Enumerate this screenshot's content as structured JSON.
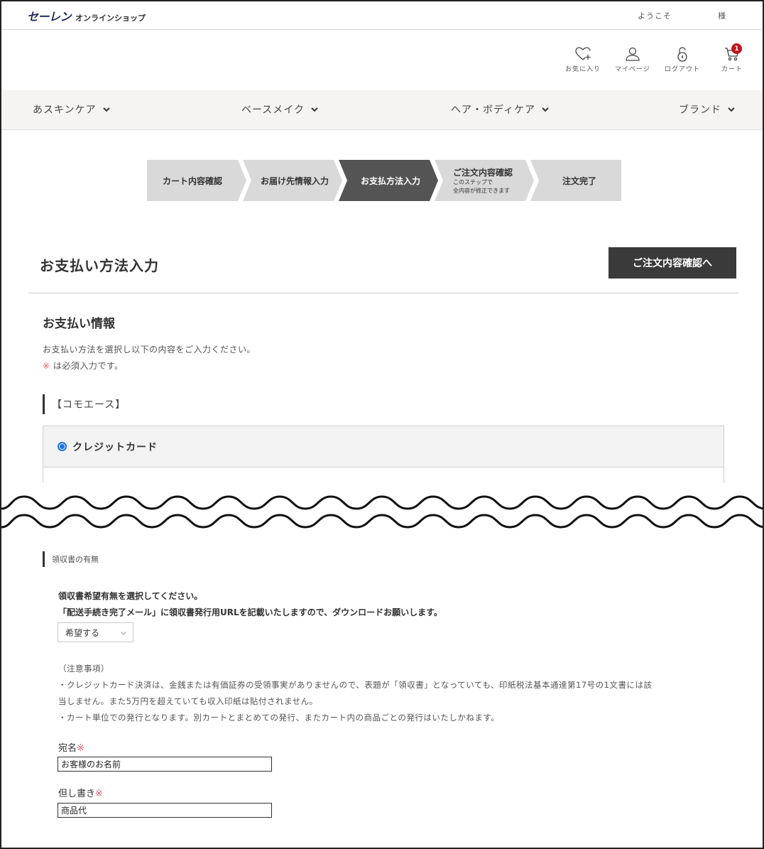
{
  "header": {
    "logo_main": "セーレン",
    "logo_sub": "オンラインショップ",
    "welcome": "ようこそ",
    "honorific": "様"
  },
  "header_icons": [
    {
      "label": "お気に入り",
      "icon": "heart-plus-icon"
    },
    {
      "label": "マイページ",
      "icon": "user-icon"
    },
    {
      "label": "ログアウト",
      "icon": "unlock-icon"
    },
    {
      "label": "カート",
      "icon": "cart-icon",
      "badge": "1"
    }
  ],
  "nav": {
    "items": [
      {
        "label": "あスキンケア"
      },
      {
        "label": "ベースメイク"
      },
      {
        "label": "ヘア・ボディケア"
      },
      {
        "label": "ブランド"
      }
    ]
  },
  "steps": [
    {
      "label": "カート内容確認",
      "sub1": "",
      "sub2": "",
      "active": false
    },
    {
      "label": "お届け先情報入力",
      "sub1": "",
      "sub2": "",
      "active": false
    },
    {
      "label": "お支払方法入力",
      "sub1": "",
      "sub2": "",
      "active": true
    },
    {
      "label": "ご注文内容確認",
      "sub1": "このステップで",
      "sub2": "全内容が修正できます",
      "active": false
    },
    {
      "label": "注文完了",
      "sub1": "",
      "sub2": "",
      "active": false
    }
  ],
  "page": {
    "title": "お支払い方法入力",
    "next_button": "ご注文内容確認へ",
    "section_title": "お支払い情報",
    "description": "お支払い方法を選択し以下の内容をご入力ください。",
    "required_mark": "※",
    "required_note": " は必須入力です。",
    "group_title": "【コモエース】",
    "payment_option": "クレジットカード"
  },
  "receipt": {
    "heading": "領収書の有無",
    "line1": "領収書希望有無を選択してください。",
    "line2": "「配送手続き完了メール」に領収書発行用URLを記載いたしますので、ダウンロードお願いします。",
    "select_value": "希望する",
    "note_title": "（注意事項）",
    "note1": "・クレジットカード決済は、金銭または有価証券の受領事実がありませんので、表題が「領収書」となっていても、印紙税法基本通達第17号の1文書には該",
    "note2": "当しません。また5万円を超えていても収入印紙は貼付されません。",
    "note3": "・カート単位での発行となります。別カートとまとめての発行、またカート内の商品ごとの発行はいたしかねます。",
    "addressee_label": "宛名",
    "addressee_value": "お客様のお名前",
    "proviso_label": "但し書き",
    "proviso_value": "商品代",
    "required_mark": "※"
  },
  "colors": {
    "accent_dark": "#3a3a3a",
    "required_red": "#e05a66",
    "badge_red": "#c0131b",
    "step_inactive": "#d9d9d9",
    "step_active": "#545454",
    "logo_navy": "#1f2d5c"
  }
}
